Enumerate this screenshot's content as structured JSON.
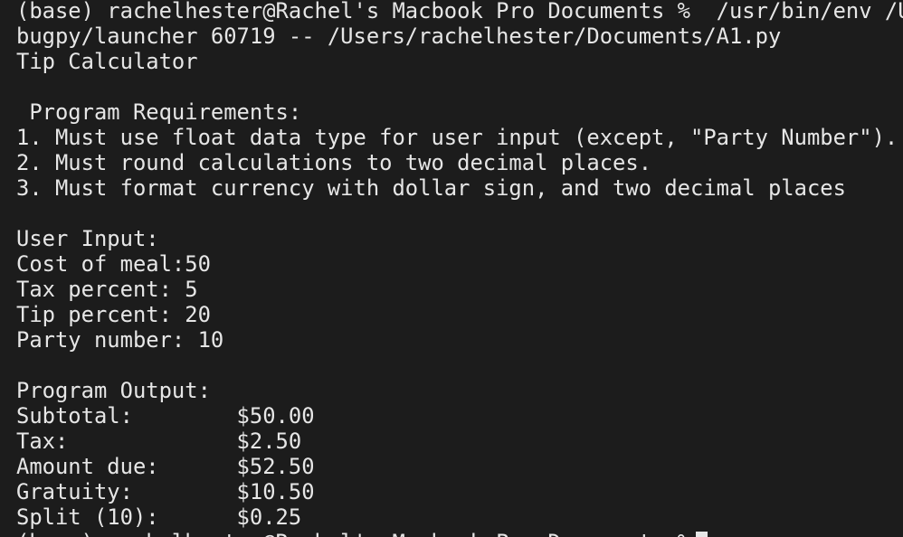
{
  "terminal": {
    "lines": [
      "(base) rachelhester@Rachel's Macbook Pro Documents %  /usr/bin/env /Us",
      "bugpy/launcher 60719 -- /Users/rachelhester/Documents/A1.py",
      "Tip Calculator",
      "",
      " Program Requirements:",
      "1. Must use float data type for user input (except, \"Party Number\").",
      "2. Must round calculations to two decimal places.",
      "3. Must format currency with dollar sign, and two decimal places",
      "",
      "User Input:",
      "Cost of meal:50",
      "Tax percent: 5",
      "Tip percent: 20",
      "Party number: 10",
      "",
      "Program Output:",
      "Subtotal:        $50.00",
      "Tax:             $2.50",
      "Amount due:      $52.50",
      "Gratuity:        $10.50",
      "Split (10):      $0.25",
      "(base) rachelhester@Rachel's Macbook Pro Documents %"
    ]
  }
}
